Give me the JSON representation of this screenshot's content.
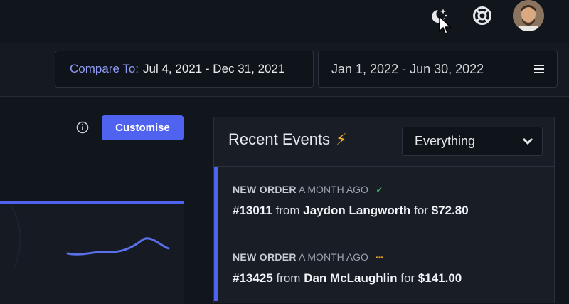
{
  "header": {
    "icons": [
      "moon-stars-icon",
      "life-ring-icon",
      "user-avatar"
    ]
  },
  "toolbar": {
    "compare_label": "Compare To:",
    "compare_range": "Jul 4, 2021 - Dec 31, 2021",
    "date_range": "Jan 1, 2022 - Jun 30, 2022",
    "menu_icon": "hamburger-menu-icon"
  },
  "dashboard": {
    "customise_label": "Customise",
    "info_icon": "info-icon"
  },
  "recent_events": {
    "title": "Recent Events",
    "title_icon": "⚡",
    "filter_value": "Everything",
    "events": [
      {
        "type": "NEW ORDER",
        "time": "A MONTH AGO",
        "status": "complete",
        "status_icon": "✓",
        "order": "#13011",
        "from_text": "from",
        "customer": "Jaydon Langworth",
        "for_text": "for",
        "amount": "$72.80"
      },
      {
        "type": "NEW ORDER",
        "time": "A MONTH AGO",
        "status": "pending",
        "status_icon": "···",
        "order": "#13425",
        "from_text": "from",
        "customer": "Dan McLaughlin",
        "for_text": "for",
        "amount": "$141.00"
      }
    ]
  },
  "colors": {
    "accent": "#4f63f0",
    "background": "#11151c",
    "success": "#3fbf6b",
    "warning": "#f5a524"
  }
}
